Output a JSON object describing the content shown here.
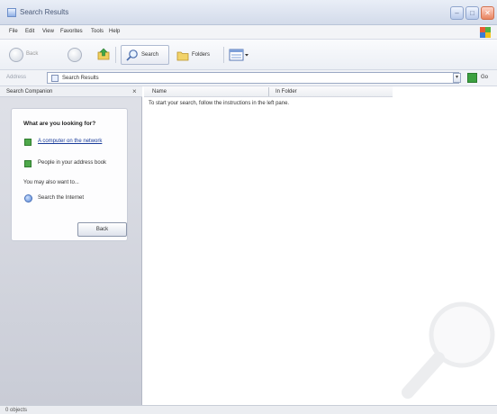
{
  "window": {
    "title": "Search Results"
  },
  "menu": {
    "items": [
      "File",
      "Edit",
      "View",
      "Favorites",
      "Tools",
      "Help"
    ]
  },
  "toolbar": {
    "back_label": "Back",
    "search_label": "Search",
    "folders_label": "Folders"
  },
  "address": {
    "label": "Address",
    "value": "Search Results",
    "go_label": "Go"
  },
  "companion": {
    "title": "Search Companion",
    "close_glyph": "×",
    "question": "What are you looking for?",
    "options": [
      "A computer on the network",
      "People in your address book"
    ],
    "also": "You may also want to...",
    "search_internet": "Search the Internet",
    "back_button": "Back"
  },
  "results": {
    "columns": [
      "Name",
      "In Folder"
    ],
    "hint": "To start your search, follow the instructions in the left pane."
  },
  "status": {
    "text": "0 objects"
  },
  "colors": {
    "accent_blue": "#1a3c9a",
    "option_green": "#4ea84a",
    "pane_background": "#d7d9e0"
  }
}
